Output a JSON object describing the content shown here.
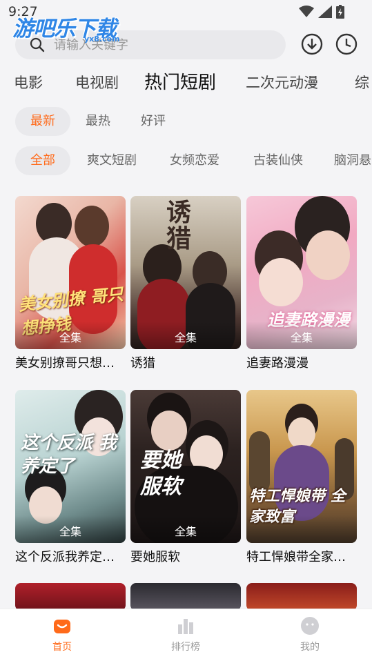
{
  "status": {
    "time": "9:27"
  },
  "watermark": {
    "main": "游吧乐下载",
    "sub": "yx8.com"
  },
  "search": {
    "placeholder": "请输入关键字"
  },
  "header_icons": [
    "download-icon",
    "history-icon"
  ],
  "primary_tabs": [
    {
      "label": "电影"
    },
    {
      "label": "电视剧"
    },
    {
      "label": "热门短剧",
      "active": true
    },
    {
      "label": "二次元动漫"
    },
    {
      "label": "综"
    }
  ],
  "sort_chips": [
    {
      "label": "最新",
      "active": true
    },
    {
      "label": "最热"
    },
    {
      "label": "好评"
    }
  ],
  "genre_chips": [
    {
      "label": "全部",
      "active": true
    },
    {
      "label": "爽文短剧"
    },
    {
      "label": "女频恋爱"
    },
    {
      "label": "古装仙侠"
    },
    {
      "label": "脑洞悬"
    }
  ],
  "accent_color": "#ff6a1a",
  "cards": [
    {
      "title": "美女别撩哥只想…",
      "badge": "全集",
      "art": "美女别撩 哥只想挣钱"
    },
    {
      "title": "诱猎",
      "badge": "全集",
      "art": "诱猎"
    },
    {
      "title": "追妻路漫漫",
      "badge": "全集",
      "art": "追妻路漫漫"
    },
    {
      "title": "这个反派我养定…",
      "badge": "全集",
      "art": "这个反派 我养定了"
    },
    {
      "title": "要她服软",
      "badge": "全集",
      "art": "要她服软"
    },
    {
      "title": "特工悍娘带全家…",
      "badge": "",
      "art": "特工悍娘带 全家致富"
    }
  ],
  "bottom_nav": [
    {
      "label": "首页",
      "icon": "home-icon",
      "active": true
    },
    {
      "label": "排行榜",
      "icon": "ranking-icon"
    },
    {
      "label": "我的",
      "icon": "profile-icon"
    }
  ]
}
